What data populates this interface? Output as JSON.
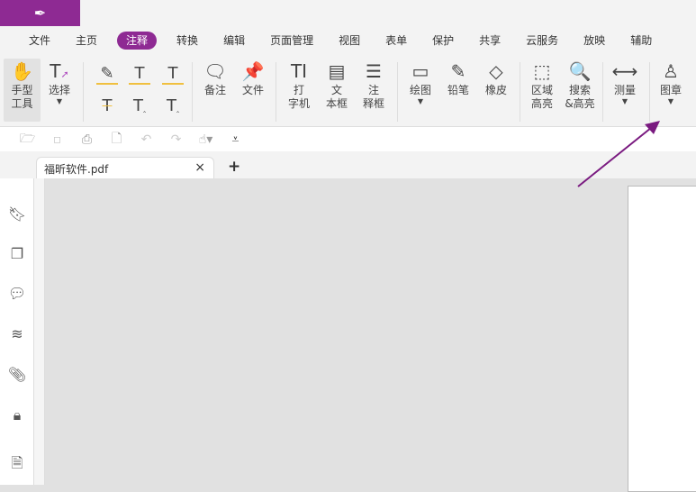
{
  "menu": [
    "文件",
    "主页",
    "注释",
    "转换",
    "编辑",
    "页面管理",
    "视图",
    "表单",
    "保护",
    "共享",
    "云服务",
    "放映",
    "辅助"
  ],
  "ribbon": {
    "hand": [
      "手型",
      "工具"
    ],
    "select": "选择",
    "note": "备注",
    "file": "文件",
    "typewriter": [
      "打",
      "字机"
    ],
    "textbox": [
      "文",
      "本框"
    ],
    "callout": [
      "注",
      "释框"
    ],
    "draw": "绘图",
    "pencil": "铅笔",
    "eraser": "橡皮",
    "area": [
      "区域",
      "高亮"
    ],
    "search": [
      "搜索",
      "&高亮"
    ],
    "measure": "测量",
    "stamp": "图章"
  },
  "tab": {
    "name": "福昕软件.pdf",
    "close": "×",
    "add": "+"
  },
  "accent": "#8e2a93"
}
